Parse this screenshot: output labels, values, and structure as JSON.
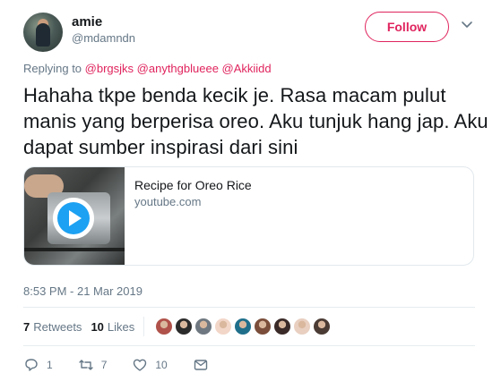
{
  "author": {
    "name": "amie",
    "handle": "@mdamndn"
  },
  "follow_label": "Follow",
  "replying": {
    "prefix": "Replying to",
    "mentions": "@brgsjks @anythgblueee @Akkiidd"
  },
  "tweet_text": "Hahaha tkpe benda kecik je. Rasa macam pulut manis yang berperisa oreo. Aku tunjuk hang jap. Aku dapat sumber inspirasi dari sini",
  "card": {
    "title": "Recipe for Oreo Rice",
    "domain": "youtube.com"
  },
  "timestamp": "8:53 PM - 21 Mar 2019",
  "stats": {
    "retweets_count": "7",
    "retweets_label": "Retweets",
    "likes_count": "10",
    "likes_label": "Likes"
  },
  "likers": [
    {
      "icon": "liker-avatar",
      "color": "#b0524a"
    },
    {
      "icon": "liker-avatar",
      "color": "#2b2b2b"
    },
    {
      "icon": "liker-avatar",
      "color": "#6f7880"
    },
    {
      "icon": "liker-avatar",
      "color": "#f2d6c8"
    },
    {
      "icon": "liker-avatar",
      "color": "#1f6f8b"
    },
    {
      "icon": "liker-avatar",
      "color": "#7a4e3a"
    },
    {
      "icon": "liker-avatar",
      "color": "#3a2a28"
    },
    {
      "icon": "liker-avatar",
      "color": "#e8cfc0"
    },
    {
      "icon": "liker-avatar",
      "color": "#4a3b34"
    }
  ],
  "actions": {
    "reply_count": "1",
    "retweet_count": "7",
    "like_count": "10"
  },
  "colors": {
    "accent": "#e0245e",
    "secondary_text": "#657786",
    "play": "#1da1f2"
  }
}
